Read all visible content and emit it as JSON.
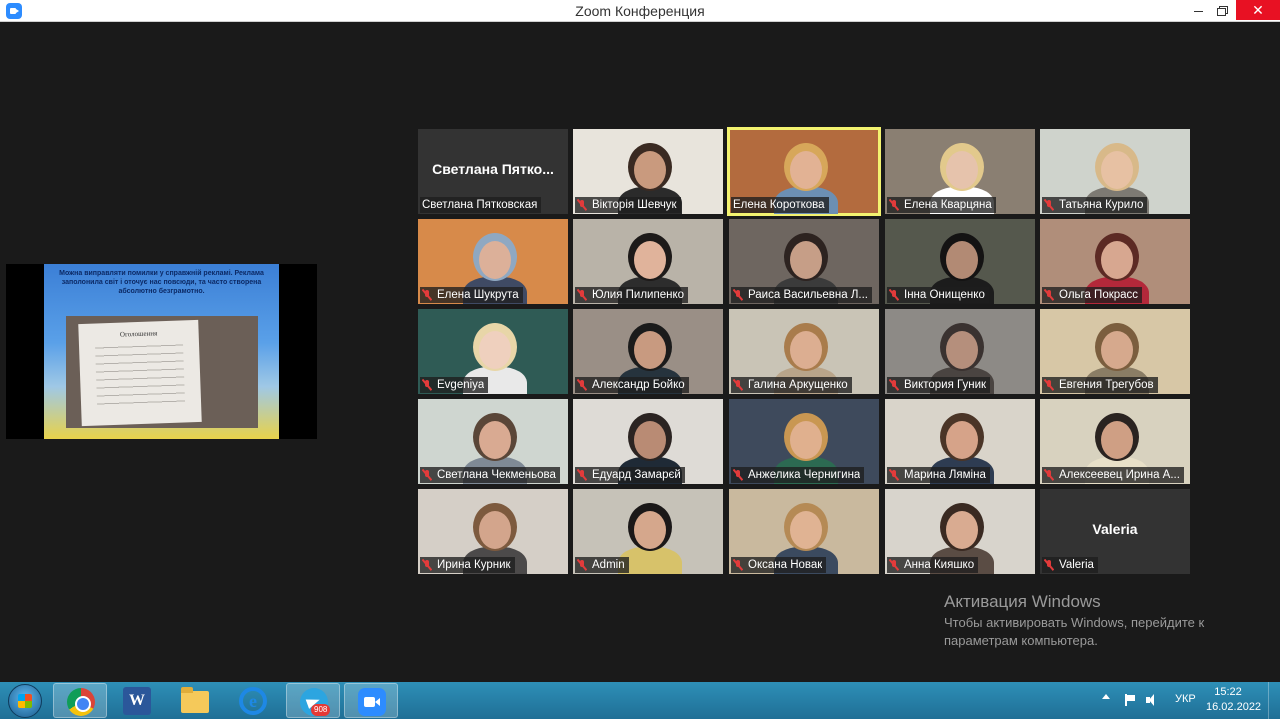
{
  "window": {
    "title": "Zoom Конференция",
    "close_glyph": "✕"
  },
  "shared_screen": {
    "slide_text": "Можна виправляти помилки у справжній рекламі. Реклама заполонила світ і оточує нас повсюди, та часто створена абсолютно безграмотно.",
    "paper_heading": "Оголошення"
  },
  "tiles": [
    {
      "name": "Светлана Пятковская",
      "display": "Светлана Пятко...",
      "video": false,
      "muted": false
    },
    {
      "name": "Вікторія Шевчук",
      "video": true,
      "muted": true,
      "bg": "#e8e4dc",
      "skin": "#c99a7e",
      "hair": "#3a2a22",
      "shirt": "#2b2b2b"
    },
    {
      "name": "Елена Короткова",
      "video": true,
      "muted": false,
      "active": true,
      "bg": "#b36b3e",
      "skin": "#e2b294",
      "hair": "#d7a75a",
      "shirt": "#6c8fb3"
    },
    {
      "name": "Елена Кварцяна",
      "video": true,
      "muted": true,
      "bg": "#8a7f72",
      "skin": "#e6c3ac",
      "hair": "#e2c98c",
      "shirt": "#ffffff"
    },
    {
      "name": "Татьяна Курило",
      "video": true,
      "muted": true,
      "bg": "#cfd3cc",
      "skin": "#e7c1a3",
      "hair": "#d8b989",
      "shirt": "#7d7a73"
    },
    {
      "name": "Елена Шукрута",
      "video": true,
      "muted": true,
      "bg": "#d78a4a",
      "skin": "#dcb099",
      "hair": "#8fa8c2",
      "shirt": "#3f4a64"
    },
    {
      "name": "Юлия Пилипенко",
      "video": true,
      "muted": true,
      "bg": "#b9b3a8",
      "skin": "#e0b39b",
      "hair": "#1d1a19",
      "shirt": "#2d2d2d"
    },
    {
      "name": "Раиса Васильевна Л...",
      "video": true,
      "muted": true,
      "bg": "#6e6660",
      "skin": "#c69e87",
      "hair": "#2d2320",
      "shirt": "#3b3b3b"
    },
    {
      "name": "Інна Онищенко",
      "video": true,
      "muted": true,
      "bg": "#55584d",
      "skin": "#b28a74",
      "hair": "#141313",
      "shirt": "#1c1c1c"
    },
    {
      "name": "Ольга Покрасс",
      "video": true,
      "muted": true,
      "bg": "#b08e7a",
      "skin": "#d7a790",
      "hair": "#5c2a24",
      "shirt": "#b3283a"
    },
    {
      "name": "Evgeniya",
      "video": true,
      "muted": true,
      "bg": "#2f5b55",
      "skin": "#efd0be",
      "hair": "#e8d6a8",
      "shirt": "#e9e9e9"
    },
    {
      "name": "Александр Бойко",
      "video": true,
      "muted": true,
      "bg": "#9a8f86",
      "skin": "#c89a80",
      "hair": "#1b1b1b",
      "shirt": "#26333d"
    },
    {
      "name": "Галина Аркущенко",
      "video": true,
      "muted": true,
      "bg": "#c9c4b6",
      "skin": "#dcae91",
      "hair": "#a97c4c",
      "shirt": "#b9a58a"
    },
    {
      "name": "Виктория Гуник",
      "video": true,
      "muted": true,
      "bg": "#8d8a86",
      "skin": "#b58f7c",
      "hair": "#3a3230",
      "shirt": "#4a4441"
    },
    {
      "name": "Евгения Трегубов",
      "video": true,
      "muted": true,
      "bg": "#d7c7a6",
      "skin": "#d6a98d",
      "hair": "#7b5e3e",
      "shirt": "#8a7d65"
    },
    {
      "name": "Светлана Чекменьова",
      "video": true,
      "muted": true,
      "bg": "#cfd6d0",
      "skin": "#d9aa92",
      "hair": "#5a4638",
      "shirt": "#7f8a96"
    },
    {
      "name": "Едуард Замарєй",
      "video": true,
      "muted": true,
      "bg": "#dedbd6",
      "skin": "#b98b74",
      "hair": "#2b2422",
      "shirt": "#1f2a36"
    },
    {
      "name": "Анжелика Чернигина",
      "video": true,
      "muted": true,
      "bg": "#3e4a5c",
      "skin": "#e0b08e",
      "hair": "#c99752",
      "shirt": "#2c6a52"
    },
    {
      "name": "Марина Ляміна",
      "video": true,
      "muted": true,
      "bg": "#d9d4ca",
      "skin": "#d6a389",
      "hair": "#4b3527",
      "shirt": "#2e3c52"
    },
    {
      "name": "Алексеевец Ирина А...",
      "video": true,
      "muted": true,
      "bg": "#d8d2bf",
      "skin": "#cf9f84",
      "hair": "#2a2320",
      "shirt": "#e8e0c8"
    },
    {
      "name": "Ирина Курник",
      "video": true,
      "muted": true,
      "bg": "#d5cfc7",
      "skin": "#d3a58c",
      "hair": "#7d5a3e",
      "shirt": "#4c4a4a"
    },
    {
      "name": "Admin",
      "video": true,
      "muted": true,
      "bg": "#c6c2b8",
      "skin": "#d5a78c",
      "hair": "#1b1818",
      "shirt": "#d7c26a"
    },
    {
      "name": "Оксана Новак",
      "video": true,
      "muted": true,
      "bg": "#c9b99e",
      "skin": "#e0b393",
      "hair": "#b58a55",
      "shirt": "#3b4a5f"
    },
    {
      "name": "Анна Кияшко",
      "video": true,
      "muted": true,
      "bg": "#d8d4cc",
      "skin": "#d9ab91",
      "hair": "#3a2a22",
      "shirt": "#5a4c44"
    },
    {
      "name": "Valeria",
      "display": "Valeria",
      "video": false,
      "muted": true
    }
  ],
  "activation": {
    "title": "Активация Windows",
    "line1": "Чтобы активировать Windows, перейдите к",
    "line2": "параметрам компьютера."
  },
  "taskbar": {
    "word_letter": "W",
    "ie_letter": "e",
    "telegram_badge": "908",
    "language": "УКР",
    "time": "15:22",
    "date": "16.02.2022"
  }
}
